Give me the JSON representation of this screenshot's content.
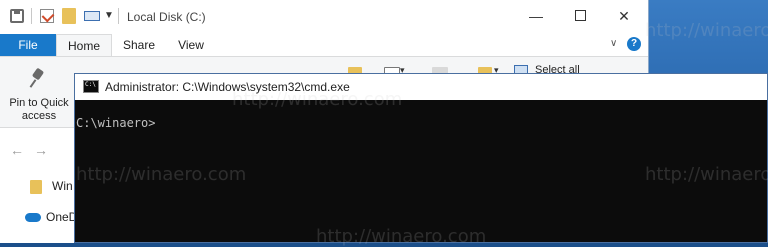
{
  "explorer": {
    "title": "Local Disk (C:)",
    "tabs": {
      "file": "File",
      "home": "Home",
      "share": "Share",
      "view": "View"
    },
    "ribbon": {
      "pin_label": "Pin to Quick access",
      "select_all": "Select all"
    },
    "sidebar": {
      "items": [
        "Win",
        "OneD"
      ]
    },
    "controls": {
      "minimize": "—",
      "close": "✕",
      "help": "?"
    }
  },
  "cmd": {
    "title": "Administrator: C:\\Windows\\system32\\cmd.exe",
    "prompt": "C:\\winaero>"
  },
  "watermark": {
    "text": "http://winaero.com"
  }
}
